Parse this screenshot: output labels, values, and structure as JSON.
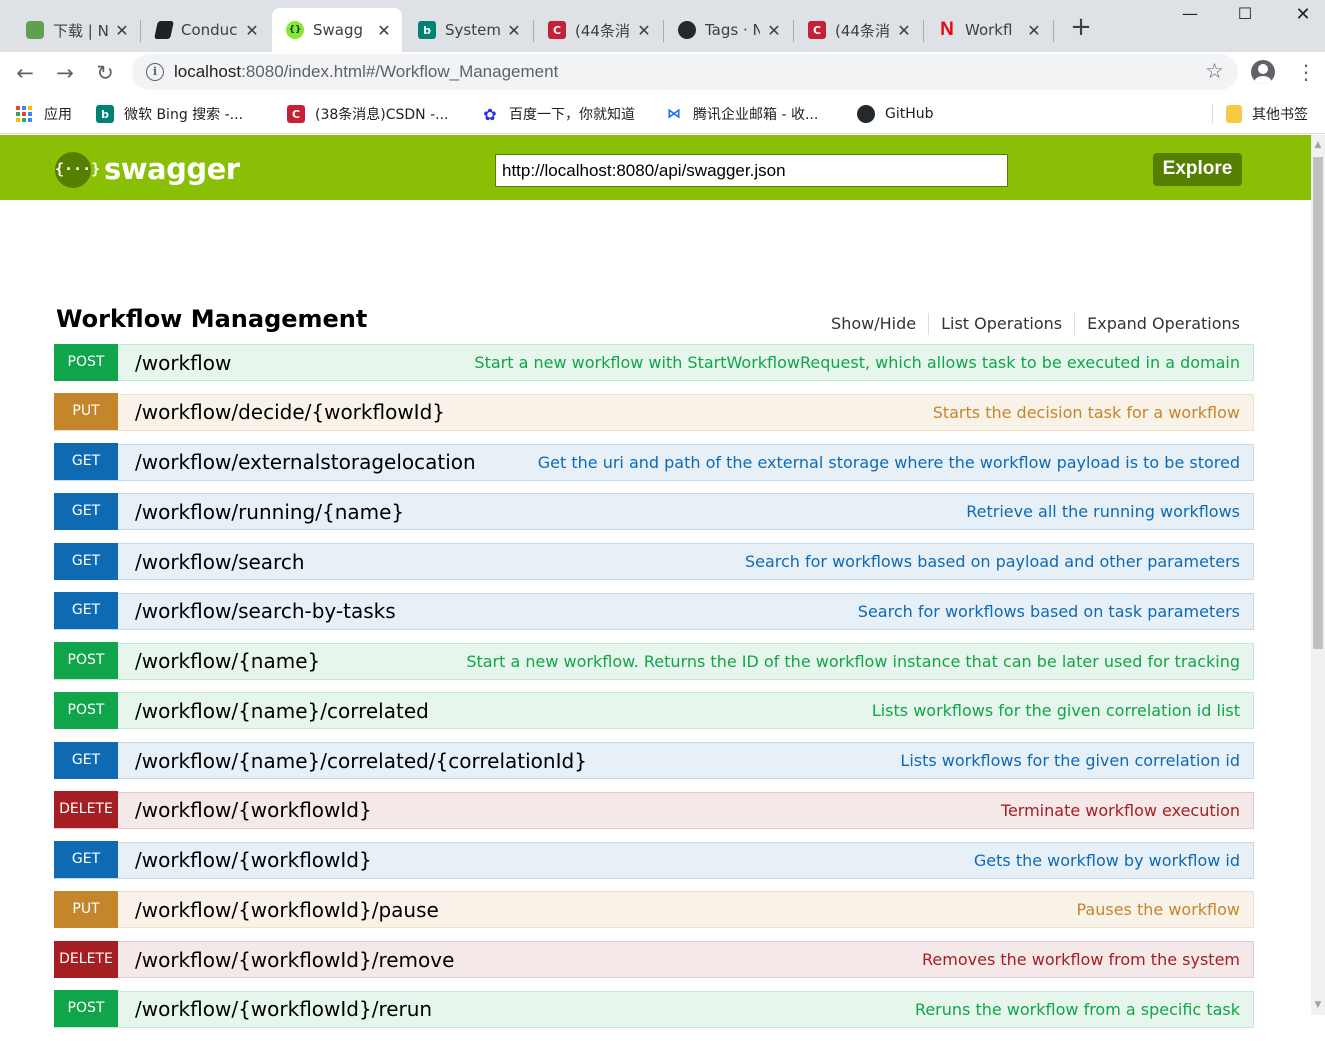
{
  "browser": {
    "tabs": [
      {
        "title": "下载 | N",
        "icon": "node-icon",
        "color": "#5fa04e",
        "active": false
      },
      {
        "title": "Conduc",
        "icon": "book-icon",
        "color": "#202124",
        "active": false
      },
      {
        "title": "Swagg",
        "icon": "swagger-icon",
        "color": "#85ea2d",
        "active": true
      },
      {
        "title": "System",
        "icon": "bing-icon",
        "color": "#008373",
        "active": false
      },
      {
        "title": "(44条消",
        "icon": "csdn-icon",
        "color": "#c32136",
        "active": false
      },
      {
        "title": "Tags · N",
        "icon": "github-icon",
        "color": "#24292e",
        "active": false
      },
      {
        "title": "(44条消",
        "icon": "csdn-icon",
        "color": "#c32136",
        "active": false
      },
      {
        "title": "Workfl",
        "icon": "netflix-icon",
        "color": "#e50914",
        "active": false
      }
    ],
    "url_host": "localhost",
    "url_rest": ":8080/index.html#/Workflow_Management",
    "bookmarks": [
      {
        "label": "应用",
        "icon": "apps-grid-icon"
      },
      {
        "label": "微软 Bing 搜索 -...",
        "icon": "bing-icon",
        "color": "#008373"
      },
      {
        "label": "(38条消息)CSDN -...",
        "icon": "csdn-icon",
        "color": "#c32136"
      },
      {
        "label": "百度一下，你就知道",
        "icon": "baidu-paw-icon",
        "color": "#2932e1"
      },
      {
        "label": "腾讯企业邮箱 - 收...",
        "icon": "tencent-mail-icon",
        "color": "#1a73e8"
      },
      {
        "label": "GitHub",
        "icon": "github-icon",
        "color": "#24292e"
      },
      {
        "label": "其他书签",
        "icon": "folder-icon",
        "color": "#f7c948"
      }
    ]
  },
  "swagger": {
    "brand": "swagger",
    "logo_glyph": "{···}",
    "spec_url": "http://localhost:8080/api/swagger.json",
    "explore_label": "Explore"
  },
  "resource": {
    "title": "Workflow Management",
    "links": [
      "Show/Hide",
      "List Operations",
      "Expand Operations"
    ],
    "operations": [
      {
        "method": "POST",
        "path": "/workflow",
        "summary": "Start a new workflow with StartWorkflowRequest, which allows task to be executed in a domain"
      },
      {
        "method": "PUT",
        "path": "/workflow/decide/{workflowId}",
        "summary": "Starts the decision task for a workflow"
      },
      {
        "method": "GET",
        "path": "/workflow/externalstoragelocation",
        "summary": "Get the uri and path of the external storage where the workflow payload is to be stored"
      },
      {
        "method": "GET",
        "path": "/workflow/running/{name}",
        "summary": "Retrieve all the running workflows"
      },
      {
        "method": "GET",
        "path": "/workflow/search",
        "summary": "Search for workflows based on payload and other parameters"
      },
      {
        "method": "GET",
        "path": "/workflow/search-by-tasks",
        "summary": "Search for workflows based on task parameters"
      },
      {
        "method": "POST",
        "path": "/workflow/{name}",
        "summary": "Start a new workflow. Returns the ID of the workflow instance that can be later used for tracking"
      },
      {
        "method": "POST",
        "path": "/workflow/{name}/correlated",
        "summary": "Lists workflows for the given correlation id list"
      },
      {
        "method": "GET",
        "path": "/workflow/{name}/correlated/{correlationId}",
        "summary": "Lists workflows for the given correlation id"
      },
      {
        "method": "DELETE",
        "path": "/workflow/{workflowId}",
        "summary": "Terminate workflow execution"
      },
      {
        "method": "GET",
        "path": "/workflow/{workflowId}",
        "summary": "Gets the workflow by workflow id"
      },
      {
        "method": "PUT",
        "path": "/workflow/{workflowId}/pause",
        "summary": "Pauses the workflow"
      },
      {
        "method": "DELETE",
        "path": "/workflow/{workflowId}/remove",
        "summary": "Removes the workflow from the system"
      },
      {
        "method": "POST",
        "path": "/workflow/{workflowId}/rerun",
        "summary": "Reruns the workflow from a specific task"
      }
    ]
  }
}
